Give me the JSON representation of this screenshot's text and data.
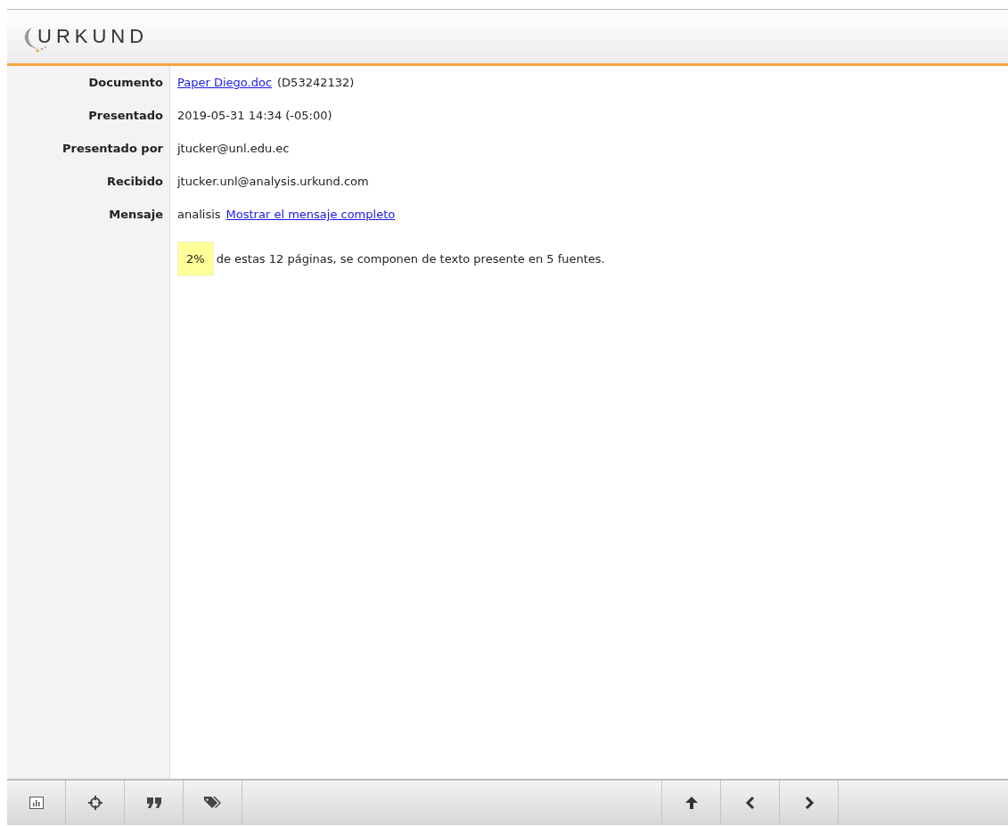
{
  "header": {
    "logo": "URKUND"
  },
  "details": [
    {
      "label": "Documento",
      "parts": [
        {
          "kind": "link",
          "text": "Paper Diego.doc"
        },
        {
          "kind": "text",
          "text": "(D53242132)"
        }
      ]
    },
    {
      "label": "Presentado",
      "parts": [
        {
          "kind": "text",
          "text": "2019-05-31 14:34 (-05:00)"
        }
      ]
    },
    {
      "label": "Presentado por",
      "parts": [
        {
          "kind": "text",
          "text": "jtucker@unl.edu.ec"
        }
      ]
    },
    {
      "label": "Recibido",
      "parts": [
        {
          "kind": "text",
          "text": "jtucker.unl@analysis.urkund.com"
        }
      ]
    },
    {
      "label": "Mensaje",
      "parts": [
        {
          "kind": "text",
          "text": "analisis"
        },
        {
          "kind": "link",
          "text": "Mostrar el mensaje completo"
        }
      ]
    }
  ],
  "summary": {
    "percent": "2%",
    "text": "de estas 12 páginas, se componen de texto presente en 5 fuentes."
  },
  "toolbar": {
    "left": [
      {
        "kind": "chart"
      },
      {
        "kind": "target"
      },
      {
        "kind": "quote"
      },
      {
        "kind": "tags"
      }
    ],
    "right": [
      {
        "kind": "up"
      },
      {
        "kind": "prev"
      },
      {
        "kind": "next"
      }
    ]
  }
}
